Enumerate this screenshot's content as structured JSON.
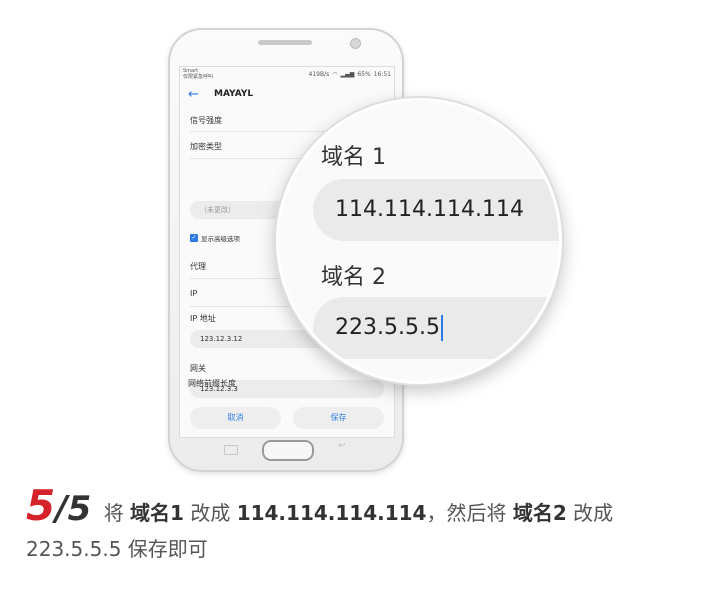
{
  "statusbar": {
    "carrier_line1": "Smart",
    "carrier_line2": "仅限紧急呼叫",
    "speed": "419B/s",
    "battery": "65%",
    "time": "16:51"
  },
  "appbar": {
    "title": "MAYAYL"
  },
  "form": {
    "signal_label": "信号强度",
    "encryption_label": "加密类型",
    "password_placeholder": "（未更改）",
    "advanced_label": "显示高级选项",
    "proxy_label": "代理",
    "ip_label": "IP",
    "ip_address_label": "IP 地址",
    "ip_address_value": "123.12.3.12",
    "gateway_label": "网关",
    "gateway_value": "123.12.3.3",
    "prefix_label": "网络前缀长度"
  },
  "buttons": {
    "cancel": "取消",
    "save": "保存"
  },
  "magnifier": {
    "dns1_label": "域名 1",
    "dns1_value": "114.114.114.114",
    "dns2_label": "域名 2",
    "dns2_value": "223.5.5.5"
  },
  "caption": {
    "step_current": "5",
    "step_sep": "/",
    "step_total": "5",
    "t1": "将",
    "t2": "域名1",
    "t3": "改成",
    "t4": "114.114.114.114",
    "t5": "，然后将",
    "t6": "域名2",
    "t7": "改成",
    "t8": "223.5.5.5",
    "t9": "保存即可"
  },
  "colors": {
    "accent": "#2c7be5",
    "step": "#d6222a"
  }
}
